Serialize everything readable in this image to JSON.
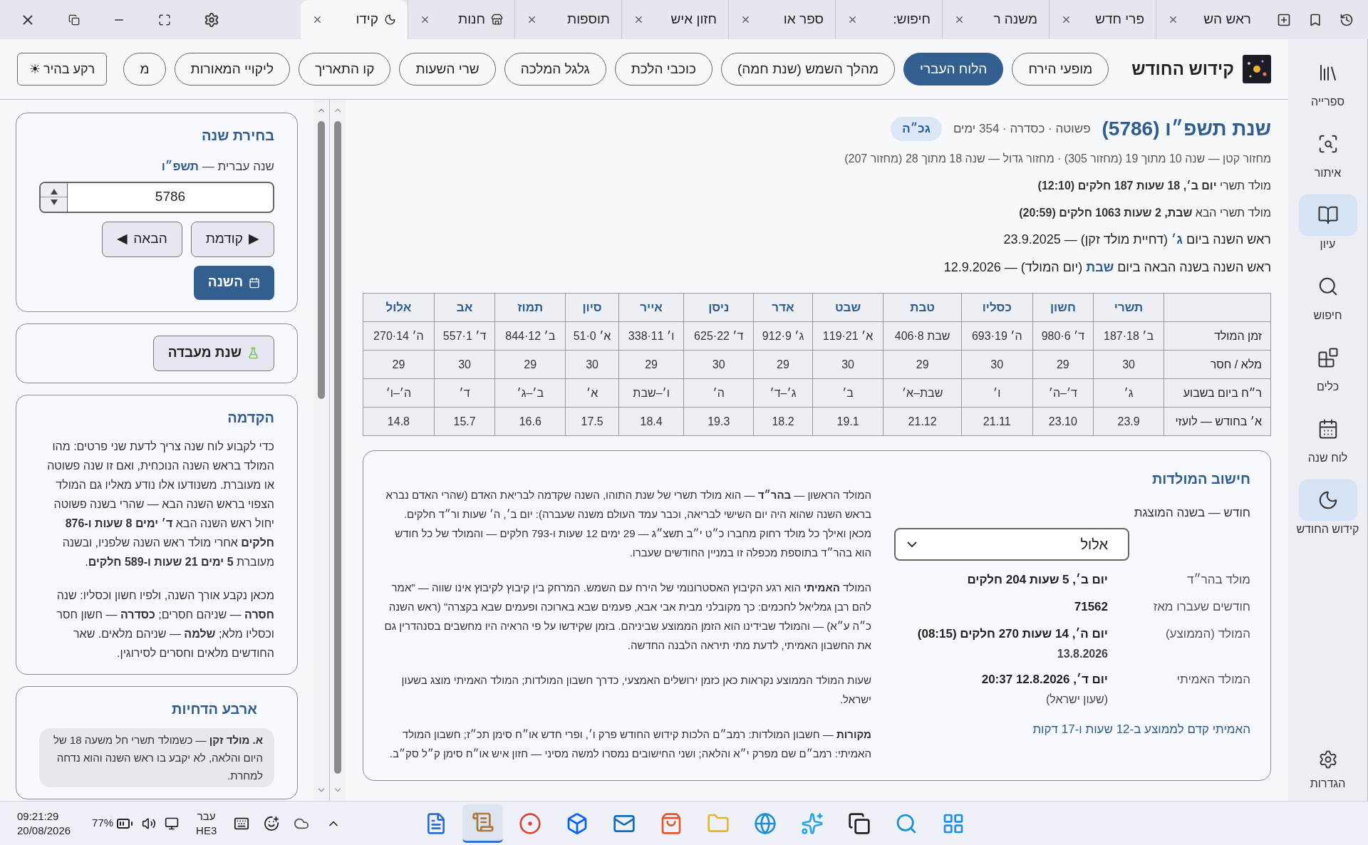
{
  "tabs": [
    {
      "label": "ראש הש",
      "kind": "text",
      "selected": false
    },
    {
      "label": "פרי חדש",
      "kind": "text",
      "selected": false
    },
    {
      "label": "משנה ר",
      "kind": "text",
      "selected": false
    },
    {
      "label": "חיפוש:",
      "kind": "text",
      "selected": false
    },
    {
      "label": "ספר או",
      "kind": "text",
      "selected": false
    },
    {
      "label": "חזון איש",
      "kind": "text",
      "selected": false
    },
    {
      "label": "תוספות",
      "kind": "text",
      "selected": false
    },
    {
      "label": "חנות",
      "kind": "store",
      "selected": false
    },
    {
      "label": "קידו",
      "kind": "moon",
      "selected": true
    }
  ],
  "toolbar": {
    "title": "קידוש החודש",
    "buttons": [
      {
        "label": "מופעי הירח",
        "selected": false
      },
      {
        "label": "הלוח העברי",
        "selected": true
      },
      {
        "label": "מהלך השמש (שנת חמה)",
        "selected": false
      },
      {
        "label": "כוכבי הלכת",
        "selected": false
      },
      {
        "label": "גלגל המלכה",
        "selected": false
      },
      {
        "label": "שרי השעות",
        "selected": false
      },
      {
        "label": "קו התאריך",
        "selected": false
      },
      {
        "label": "ליקויי המאורות",
        "selected": false
      },
      {
        "label": "מ",
        "selected": false
      }
    ],
    "theme_button": {
      "icon": "☀",
      "label": "רקע בהיר"
    }
  },
  "left_panel": {
    "year_card": {
      "title": "בחירת שנה",
      "label": "שנה עברית — **תשפ״ו**",
      "value": "5786",
      "prev": {
        "arrow": "▶",
        "label": "קודמת"
      },
      "next": {
        "arrow": "◀",
        "label": "הבאה"
      },
      "current": "השנה"
    },
    "lab_button": "שנת מעבדה",
    "intro": {
      "title": "הקדמה",
      "paragraphs": [
        "כדי לקבוע לוח שנה צריך לדעת שני פרטים: מהו המולד בראש השנה הנוכחית, ואם זו שנה פשוטה או מעוברת. משנודעו אלו נודע מאליו גם המולד הצפוי בראש השנה הבא — שהרי בשנה פשוטה יחול ראש השנה הבא **ד׳ ימים 8 שעות ו-876 חלקים** אחרי מולד ראש השנה שלפניו, ובשנה מעוברת **5 ימים 21 שעות ו-589 חלקים**.",
        "מכאן נקבע אורך השנה, ולפיו חשון וכסליו: שנה **חסרה** — שניהם חסרים; **כסדרה** — חשון חסר וכסליו מלא; **שלמה** — שניהם מלאים. שאר החודשים מלאים וחסרים לסירוגין."
      ]
    },
    "postponements": {
      "title": "ארבע הדחיות",
      "items": [
        "**א. מולד זקן** — כשמולד תשרי חל משעה 18 של היום והלאה, לא יקבע בו ראש השנה והוא נדחה למחרת."
      ]
    }
  },
  "year": {
    "title": "שנת תשפ״ו (5786)",
    "summary": "פשוטה · כסדרה · 354 ימים",
    "badge": "גכ״ה",
    "cycle": "מחזור קטן — שנה 10 מתוך 19 (מחזור 305) · מחזור גדול — שנה 18 מתוך 28 (מחזור 207)",
    "molad_lines": [
      "מולד תשרי **יום ב׳, 18 שעות 187 חלקים (12:10)**",
      "מולד תשרי הבא **שבת, 2 שעות 1063 חלקים (20:59)**"
    ],
    "rosh_hashana_lines": [
      "ראש השנה ביום **ג׳** (דחיית מולד זקן) — 23.9.2025",
      "ראש השנה בשנה הבאה ביום **שבת** (יום המולד) — 12.9.2026"
    ]
  },
  "table": {
    "columns": [
      "תשרי",
      "חשון",
      "כסליו",
      "טבת",
      "שבט",
      "אדר",
      "ניסן",
      "אייר",
      "סיון",
      "תמוז",
      "אב",
      "אלול"
    ],
    "rows": [
      {
        "label": "זמן המולד",
        "cells": [
          "ב׳ 18·187",
          "ד׳ 6·980",
          "ה׳ 19·693",
          "שבת 8·406",
          "א׳ 21·119",
          "ג׳ 9·912",
          "ד׳ 22·625",
          "ו׳ 11·338",
          "א׳ 0·51",
          "ב׳ 12·844",
          "ד׳ 1·557",
          "ה׳ 14·270"
        ]
      },
      {
        "label": "מלא / חסר",
        "cells": [
          "30",
          "29",
          "30",
          "29",
          "30",
          "29",
          "30",
          "29",
          "30",
          "29",
          "30",
          "29"
        ]
      },
      {
        "label": "ר״ח ביום בשבוע",
        "cells": [
          "ג׳",
          "ד׳–ה׳",
          "ו׳",
          "שבת–א׳",
          "ב׳",
          "ג׳–ד׳",
          "ה׳",
          "ו׳–שבת",
          "א׳",
          "ב׳–ג׳",
          "ד׳",
          "ה׳–ו׳"
        ]
      },
      {
        "label": "א׳ בחודש — לועזי",
        "cells": [
          "23.9",
          "23.10",
          "21.11",
          "21.12",
          "19.1",
          "18.2",
          "19.3",
          "18.4",
          "17.5",
          "16.6",
          "15.7",
          "14.8"
        ]
      }
    ]
  },
  "calc": {
    "title": "חישוב המולדות",
    "month_label": "חודש — בשנה המוצגת",
    "month_value": "אלול",
    "rows": [
      {
        "label": "מולד בהר״ד",
        "value": "יום ב׳, 5 שעות 204 חלקים"
      },
      {
        "label": "חודשים שעברו מאז",
        "value": "71562"
      },
      {
        "label": "המולד (הממוצע)",
        "value": "יום ה׳, 14 שעות 270 חלקים (08:15)",
        "second": "13.8.2026"
      },
      {
        "label": "המולד האמיתי",
        "value": "יום ד׳, 12.8.2026 20:37",
        "second": "(שעון ישראל)"
      }
    ],
    "link": "האמיתי קדם לממוצע ב-12 שעות ו-17 דקות",
    "paragraphs": [
      "המולד הראשון — **בהר״ד** — הוא מולד תשרי של שנת התוהו, השנה שקדמה לבריאת האדם (שהרי האדם נברא בראש השנה שהוא היה יום השישי לבריאה, וכבר עמד העולם משנה שעברה): יום ב׳, ה׳ שעות ור״ד חלקים. מכאן ואילך כל מולד רחוק מחברו כ״ט י״ב תשצ״ג — 29 ימים 12 שעות ו-793 חלקים — והמולד של כל חודש הוא בהר״ד בתוספת מכפלה זו במניין החודשים שעברו.",
      "המולד **האמיתי** הוא רגע הקיבוץ האסטרונומי של הירח עם השמש. המרחק בין קיבוץ לקיבוץ אינו שווה — \"אמר להם רבן גמליאל לחכמים: כך מקובלני מבית אבי אבא, פעמים שבא בארוכה ופעמים שבא בקצרה\" (ראש השנה כ״ה ע״א) — והמולד שבידינו הוא הזמן הממוצע שביניהם. בזמן שקידשו על פי הראיה היו מחשבים בסנהדרין גם את החשבון האמיתי, לדעת מתי תיראה הלבנה החדשה.",
      "שעות המולד הממוצע נקראות כאן כזמן ירושלים האמצעי, כדרך חשבון המולדות; המולד האמיתי מוצג בשעון ישראל.",
      "**מקורות** — חשבון המולדות: רמב״ם הלכות קידוש החודש פרק ו׳, ופרי חדש או״ח סימן תכ״ז; חשבון המולד האמיתי: רמב״ם שם מפרק י״א והלאה; ושני החישובים נמסרו למשה מסיני — חזון איש או״ח סימן ק״ל סק״ב."
    ]
  },
  "sidebar": {
    "items": [
      {
        "label": "ספרייה",
        "selected": false
      },
      {
        "label": "איתור",
        "selected": false
      },
      {
        "label": "עיון",
        "selected": true
      },
      {
        "label": "חיפוש",
        "selected": false
      },
      {
        "label": "כלים",
        "selected": false
      },
      {
        "label": "לוח שנה",
        "selected": false
      },
      {
        "label": "קידוש החודש",
        "selected": true
      }
    ],
    "settings": "הגדרות"
  },
  "taskbar": {
    "time": "09:21:29",
    "date": "20/08/2026",
    "battery": "77%",
    "language": "עבר",
    "layout": "HE3",
    "apps": [
      {
        "selected": false
      },
      {
        "selected": true
      },
      {
        "selected": false
      },
      {
        "selected": false
      },
      {
        "selected": false
      },
      {
        "selected": false
      },
      {
        "selected": false
      },
      {
        "selected": false
      },
      {
        "selected": false
      },
      {
        "selected": false
      },
      {
        "selected": false
      },
      {
        "selected": false
      }
    ]
  }
}
